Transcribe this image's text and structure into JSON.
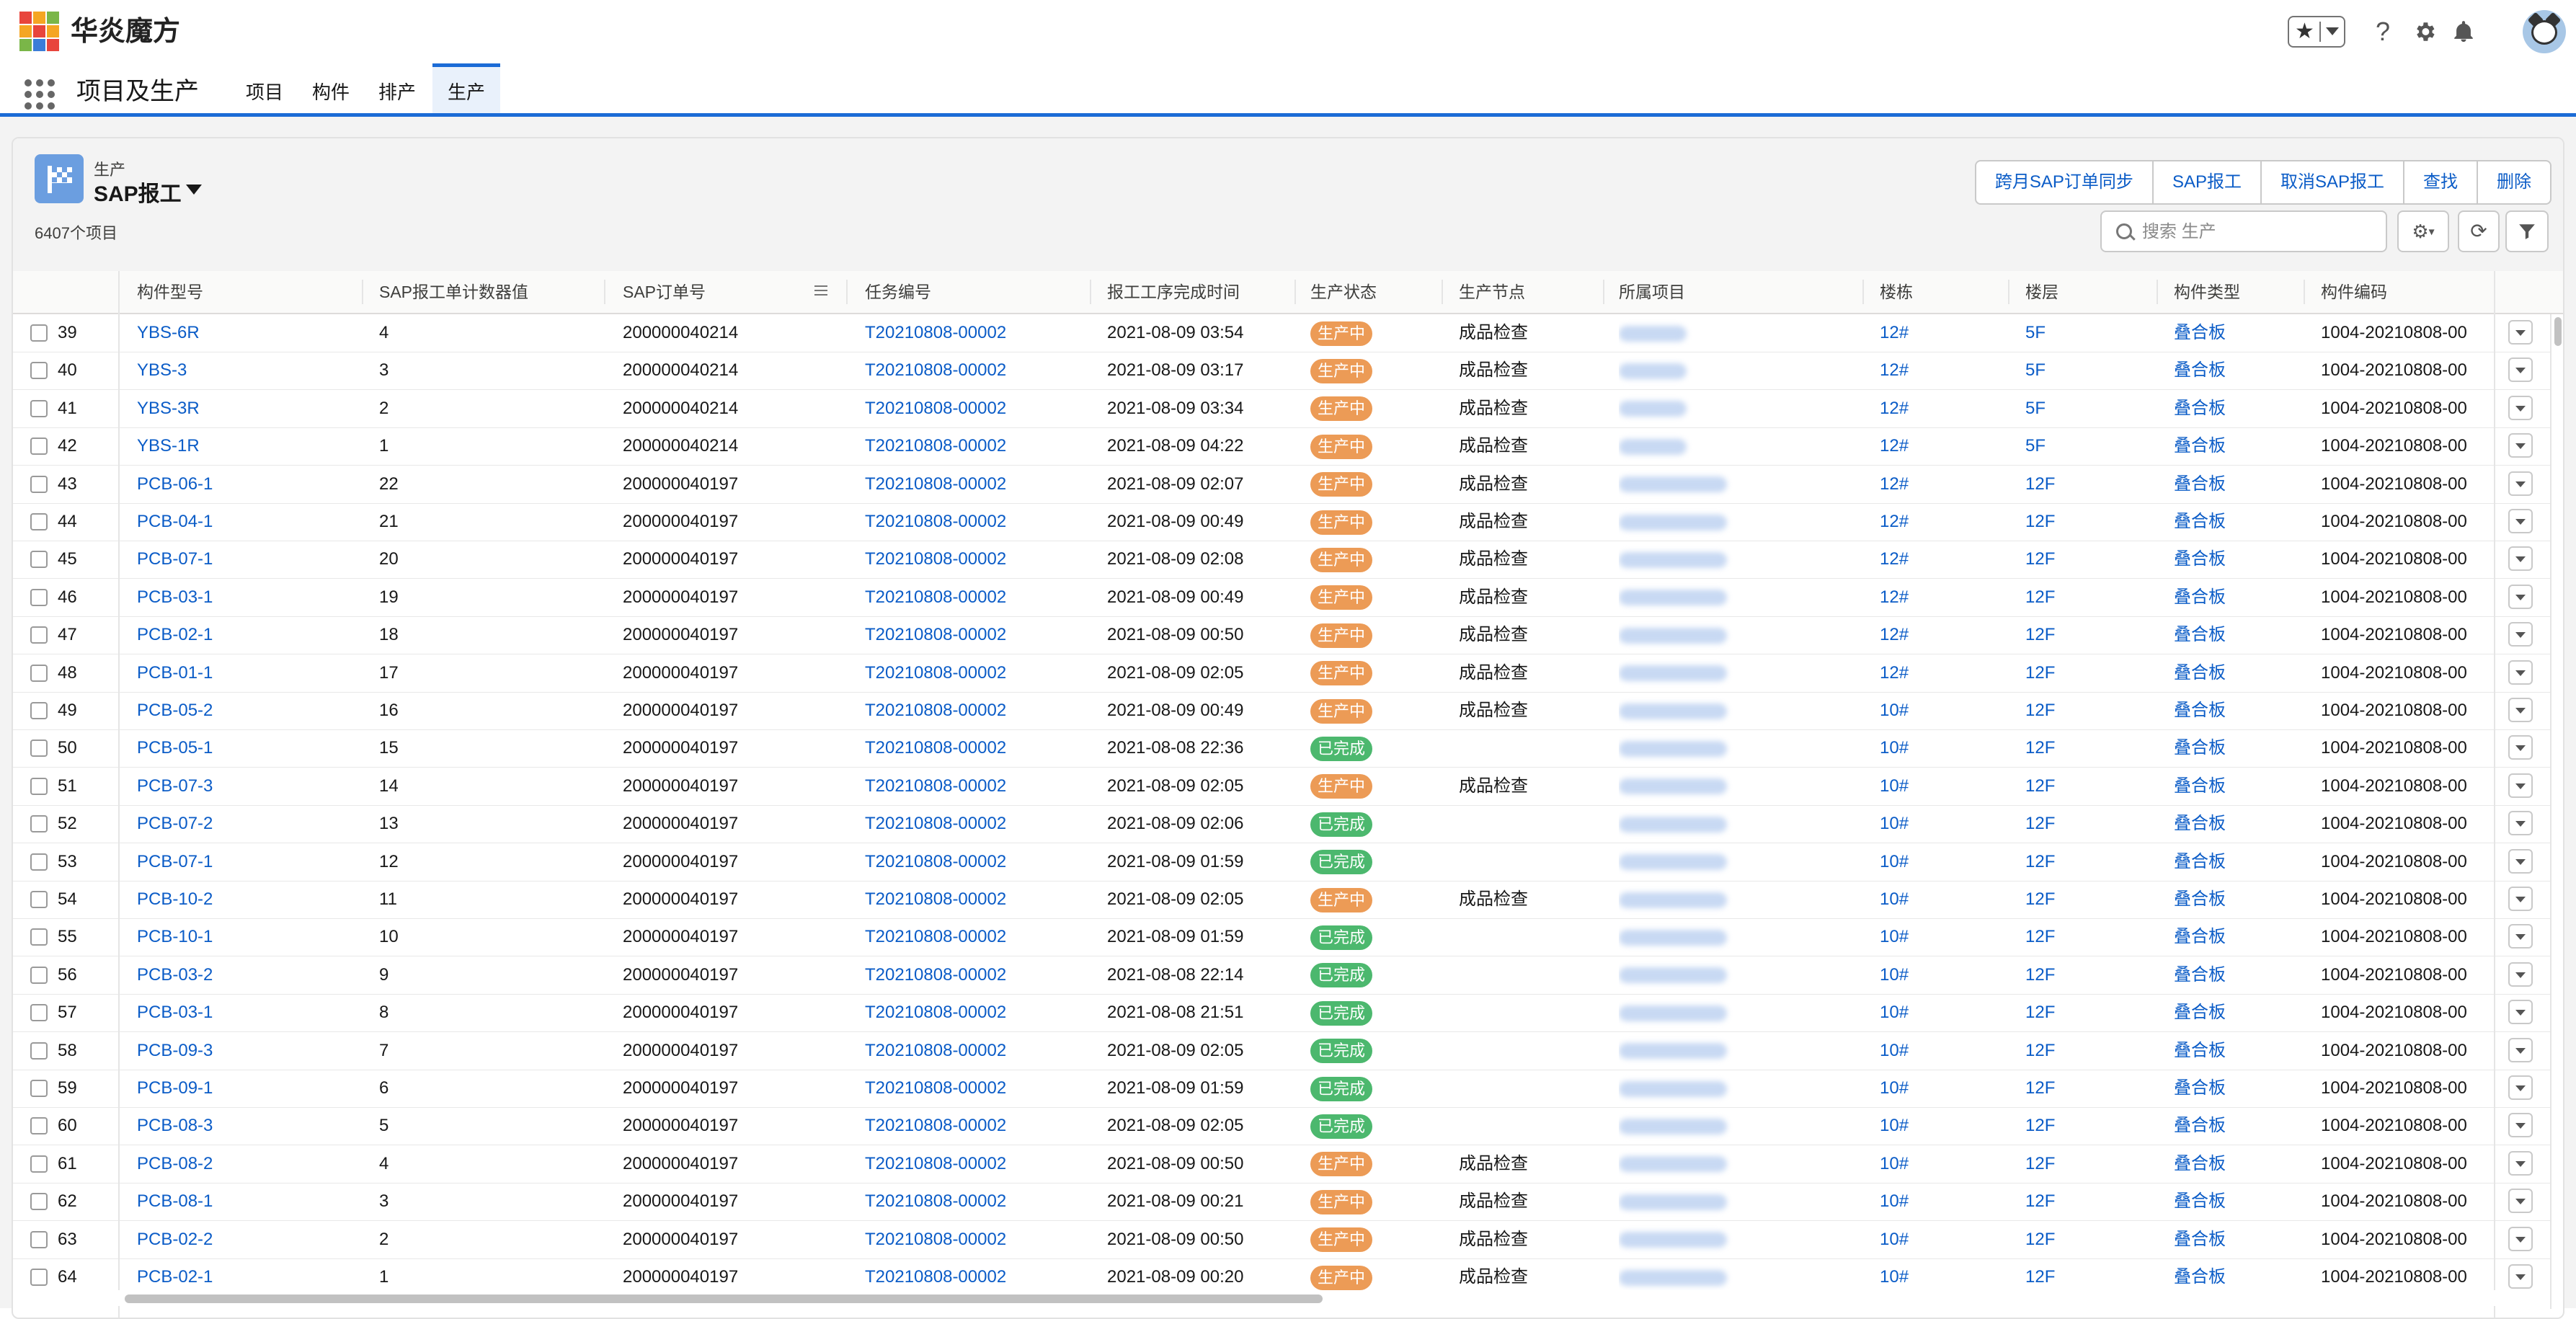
{
  "brand": {
    "name": "华炎魔方"
  },
  "header_icons": {
    "favorites": "star-icon",
    "help": "?",
    "setup": "gear-icon",
    "notifications": "bell-icon"
  },
  "nav": {
    "app_name": "项目及生产",
    "tabs": [
      {
        "label": "项目"
      },
      {
        "label": "构件"
      },
      {
        "label": "排产"
      },
      {
        "label": "生产",
        "active": true
      }
    ]
  },
  "list_view": {
    "object_label": "生产",
    "title": "SAP报工",
    "count_text": "6407个项目",
    "buttons": [
      "跨月SAP订单同步",
      "SAP报工",
      "取消SAP报工",
      "查找",
      "删除"
    ],
    "search_placeholder": "搜索 生产"
  },
  "colors": {
    "in_progress": "#ec9b56",
    "done": "#4cb86e",
    "link": "#0b5cc7",
    "accent": "#1b6bd6"
  },
  "table": {
    "columns": [
      "构件型号",
      "SAP报工单计数器值",
      "SAP订单号",
      "任务编号",
      "报工工序完成时间",
      "生产状态",
      "生产节点",
      "所属项目",
      "楼栋",
      "楼层",
      "构件类型",
      "构件编码"
    ],
    "rows": [
      {
        "n": "39",
        "model": "YBS-6R",
        "counter": "4",
        "order": "200000040214",
        "task": "T20210808-00002",
        "time": "2021-08-09 03:54",
        "status": "生产中",
        "node": "成品检查",
        "building": "12#",
        "floor": "5F",
        "type": "叠合板",
        "code": "1004-20210808-00"
      },
      {
        "n": "40",
        "model": "YBS-3",
        "counter": "3",
        "order": "200000040214",
        "task": "T20210808-00002",
        "time": "2021-08-09 03:17",
        "status": "生产中",
        "node": "成品检查",
        "building": "12#",
        "floor": "5F",
        "type": "叠合板",
        "code": "1004-20210808-00"
      },
      {
        "n": "41",
        "model": "YBS-3R",
        "counter": "2",
        "order": "200000040214",
        "task": "T20210808-00002",
        "time": "2021-08-09 03:34",
        "status": "生产中",
        "node": "成品检查",
        "building": "12#",
        "floor": "5F",
        "type": "叠合板",
        "code": "1004-20210808-00"
      },
      {
        "n": "42",
        "model": "YBS-1R",
        "counter": "1",
        "order": "200000040214",
        "task": "T20210808-00002",
        "time": "2021-08-09 04:22",
        "status": "生产中",
        "node": "成品检查",
        "building": "12#",
        "floor": "5F",
        "type": "叠合板",
        "code": "1004-20210808-00"
      },
      {
        "n": "43",
        "model": "PCB-06-1",
        "counter": "22",
        "order": "200000040197",
        "task": "T20210808-00002",
        "time": "2021-08-09 02:07",
        "status": "生产中",
        "node": "成品检查",
        "building": "12#",
        "floor": "12F",
        "type": "叠合板",
        "code": "1004-20210808-00"
      },
      {
        "n": "44",
        "model": "PCB-04-1",
        "counter": "21",
        "order": "200000040197",
        "task": "T20210808-00002",
        "time": "2021-08-09 00:49",
        "status": "生产中",
        "node": "成品检查",
        "building": "12#",
        "floor": "12F",
        "type": "叠合板",
        "code": "1004-20210808-00"
      },
      {
        "n": "45",
        "model": "PCB-07-1",
        "counter": "20",
        "order": "200000040197",
        "task": "T20210808-00002",
        "time": "2021-08-09 02:08",
        "status": "生产中",
        "node": "成品检查",
        "building": "12#",
        "floor": "12F",
        "type": "叠合板",
        "code": "1004-20210808-00"
      },
      {
        "n": "46",
        "model": "PCB-03-1",
        "counter": "19",
        "order": "200000040197",
        "task": "T20210808-00002",
        "time": "2021-08-09 00:49",
        "status": "生产中",
        "node": "成品检查",
        "building": "12#",
        "floor": "12F",
        "type": "叠合板",
        "code": "1004-20210808-00"
      },
      {
        "n": "47",
        "model": "PCB-02-1",
        "counter": "18",
        "order": "200000040197",
        "task": "T20210808-00002",
        "time": "2021-08-09 00:50",
        "status": "生产中",
        "node": "成品检查",
        "building": "12#",
        "floor": "12F",
        "type": "叠合板",
        "code": "1004-20210808-00"
      },
      {
        "n": "48",
        "model": "PCB-01-1",
        "counter": "17",
        "order": "200000040197",
        "task": "T20210808-00002",
        "time": "2021-08-09 02:05",
        "status": "生产中",
        "node": "成品检查",
        "building": "12#",
        "floor": "12F",
        "type": "叠合板",
        "code": "1004-20210808-00"
      },
      {
        "n": "49",
        "model": "PCB-05-2",
        "counter": "16",
        "order": "200000040197",
        "task": "T20210808-00002",
        "time": "2021-08-09 00:49",
        "status": "生产中",
        "node": "成品检查",
        "building": "10#",
        "floor": "12F",
        "type": "叠合板",
        "code": "1004-20210808-00"
      },
      {
        "n": "50",
        "model": "PCB-05-1",
        "counter": "15",
        "order": "200000040197",
        "task": "T20210808-00002",
        "time": "2021-08-08 22:36",
        "status": "已完成",
        "node": "",
        "building": "10#",
        "floor": "12F",
        "type": "叠合板",
        "code": "1004-20210808-00"
      },
      {
        "n": "51",
        "model": "PCB-07-3",
        "counter": "14",
        "order": "200000040197",
        "task": "T20210808-00002",
        "time": "2021-08-09 02:05",
        "status": "生产中",
        "node": "成品检查",
        "building": "10#",
        "floor": "12F",
        "type": "叠合板",
        "code": "1004-20210808-00"
      },
      {
        "n": "52",
        "model": "PCB-07-2",
        "counter": "13",
        "order": "200000040197",
        "task": "T20210808-00002",
        "time": "2021-08-09 02:06",
        "status": "已完成",
        "node": "",
        "building": "10#",
        "floor": "12F",
        "type": "叠合板",
        "code": "1004-20210808-00"
      },
      {
        "n": "53",
        "model": "PCB-07-1",
        "counter": "12",
        "order": "200000040197",
        "task": "T20210808-00002",
        "time": "2021-08-09 01:59",
        "status": "已完成",
        "node": "",
        "building": "10#",
        "floor": "12F",
        "type": "叠合板",
        "code": "1004-20210808-00"
      },
      {
        "n": "54",
        "model": "PCB-10-2",
        "counter": "11",
        "order": "200000040197",
        "task": "T20210808-00002",
        "time": "2021-08-09 02:05",
        "status": "生产中",
        "node": "成品检查",
        "building": "10#",
        "floor": "12F",
        "type": "叠合板",
        "code": "1004-20210808-00"
      },
      {
        "n": "55",
        "model": "PCB-10-1",
        "counter": "10",
        "order": "200000040197",
        "task": "T20210808-00002",
        "time": "2021-08-09 01:59",
        "status": "已完成",
        "node": "",
        "building": "10#",
        "floor": "12F",
        "type": "叠合板",
        "code": "1004-20210808-00"
      },
      {
        "n": "56",
        "model": "PCB-03-2",
        "counter": "9",
        "order": "200000040197",
        "task": "T20210808-00002",
        "time": "2021-08-08 22:14",
        "status": "已完成",
        "node": "",
        "building": "10#",
        "floor": "12F",
        "type": "叠合板",
        "code": "1004-20210808-00"
      },
      {
        "n": "57",
        "model": "PCB-03-1",
        "counter": "8",
        "order": "200000040197",
        "task": "T20210808-00002",
        "time": "2021-08-08 21:51",
        "status": "已完成",
        "node": "",
        "building": "10#",
        "floor": "12F",
        "type": "叠合板",
        "code": "1004-20210808-00"
      },
      {
        "n": "58",
        "model": "PCB-09-3",
        "counter": "7",
        "order": "200000040197",
        "task": "T20210808-00002",
        "time": "2021-08-09 02:05",
        "status": "已完成",
        "node": "",
        "building": "10#",
        "floor": "12F",
        "type": "叠合板",
        "code": "1004-20210808-00"
      },
      {
        "n": "59",
        "model": "PCB-09-1",
        "counter": "6",
        "order": "200000040197",
        "task": "T20210808-00002",
        "time": "2021-08-09 01:59",
        "status": "已完成",
        "node": "",
        "building": "10#",
        "floor": "12F",
        "type": "叠合板",
        "code": "1004-20210808-00"
      },
      {
        "n": "60",
        "model": "PCB-08-3",
        "counter": "5",
        "order": "200000040197",
        "task": "T20210808-00002",
        "time": "2021-08-09 02:05",
        "status": "已完成",
        "node": "",
        "building": "10#",
        "floor": "12F",
        "type": "叠合板",
        "code": "1004-20210808-00"
      },
      {
        "n": "61",
        "model": "PCB-08-2",
        "counter": "4",
        "order": "200000040197",
        "task": "T20210808-00002",
        "time": "2021-08-09 00:50",
        "status": "生产中",
        "node": "成品检查",
        "building": "10#",
        "floor": "12F",
        "type": "叠合板",
        "code": "1004-20210808-00"
      },
      {
        "n": "62",
        "model": "PCB-08-1",
        "counter": "3",
        "order": "200000040197",
        "task": "T20210808-00002",
        "time": "2021-08-09 00:21",
        "status": "生产中",
        "node": "成品检查",
        "building": "10#",
        "floor": "12F",
        "type": "叠合板",
        "code": "1004-20210808-00"
      },
      {
        "n": "63",
        "model": "PCB-02-2",
        "counter": "2",
        "order": "200000040197",
        "task": "T20210808-00002",
        "time": "2021-08-09 00:50",
        "status": "生产中",
        "node": "成品检查",
        "building": "10#",
        "floor": "12F",
        "type": "叠合板",
        "code": "1004-20210808-00"
      },
      {
        "n": "64",
        "model": "PCB-02-1",
        "counter": "1",
        "order": "200000040197",
        "task": "T20210808-00002",
        "time": "2021-08-09 00:20",
        "status": "生产中",
        "node": "成品检查",
        "building": "10#",
        "floor": "12F",
        "type": "叠合板",
        "code": "1004-20210808-00"
      }
    ]
  }
}
